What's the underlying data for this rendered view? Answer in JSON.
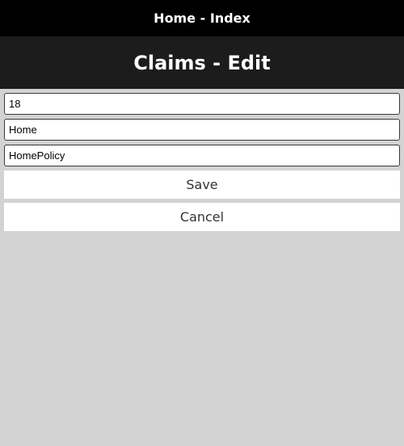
{
  "topbar": {
    "title": "Home - Index"
  },
  "header": {
    "title": "Claims - Edit"
  },
  "form": {
    "fields": [
      {
        "value": "18"
      },
      {
        "value": "Home"
      },
      {
        "value": "HomePolicy"
      }
    ],
    "save_label": "Save",
    "cancel_label": "Cancel"
  },
  "colors": {
    "topbar_bg": "#000000",
    "header_bg": "#1c1c1c",
    "page_bg": "#d3d3d3",
    "button_bg": "#ffffff"
  }
}
